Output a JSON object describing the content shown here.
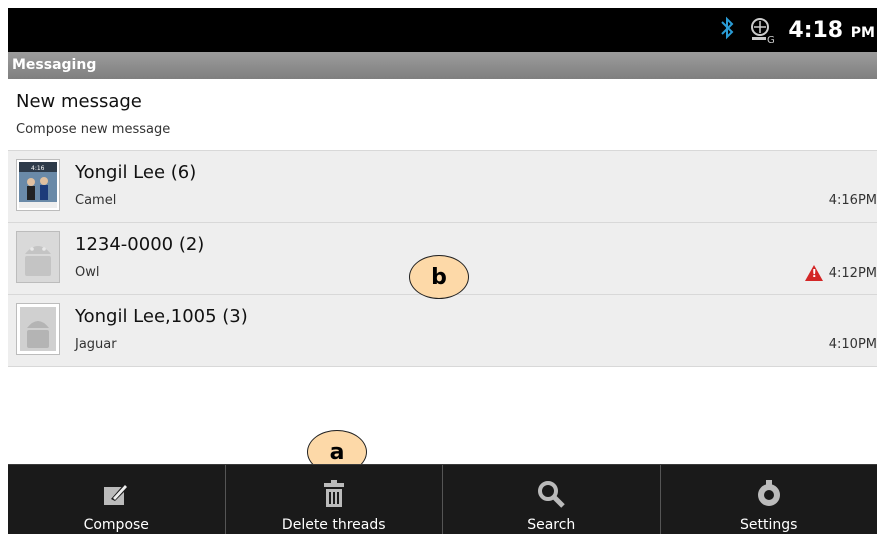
{
  "status_bar": {
    "time": "4:18",
    "ampm": "PM"
  },
  "title_bar": {
    "title": "Messaging"
  },
  "new_message": {
    "title": "New message",
    "subtitle": "Compose new message"
  },
  "threads": [
    {
      "name": "Yongil Lee (6)",
      "snippet": "Camel",
      "time": "4:16PM",
      "error": false
    },
    {
      "name": "1234-0000 (2)",
      "snippet": "Owl",
      "time": "4:12PM",
      "error": true
    },
    {
      "name": "Yongil Lee,1005 (3)",
      "snippet": "Jaguar",
      "time": "4:10PM",
      "error": false
    }
  ],
  "callouts": {
    "a": "a",
    "b": "b"
  },
  "bottom_bar": {
    "compose": "Compose",
    "delete": "Delete threads",
    "search": "Search",
    "settings": "Settings"
  },
  "icons": [
    "bluetooth-icon",
    "signal-icon",
    "compose-icon",
    "trash-icon",
    "search-icon",
    "settings-icon",
    "warning-icon"
  ]
}
